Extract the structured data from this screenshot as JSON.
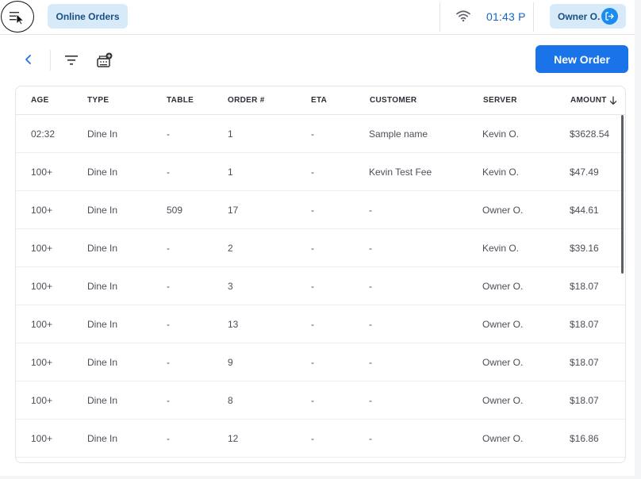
{
  "topbar": {
    "online_orders_label": "Online Orders",
    "time": "01:43 P",
    "user_label": "Owner O."
  },
  "toolbar": {
    "new_order_label": "New Order"
  },
  "table": {
    "columns": [
      "AGE",
      "TYPE",
      "TABLE",
      "ORDER #",
      "ETA",
      "CUSTOMER",
      "SERVER",
      "AMOUNT"
    ],
    "rows": [
      [
        "02:32",
        "Dine In",
        "-",
        "1",
        "-",
        "Sample name",
        "Kevin O.",
        "$3628.54"
      ],
      [
        "100+",
        "Dine In",
        "-",
        "1",
        "-",
        "Kevin Test Fee",
        "Kevin O.",
        "$47.49"
      ],
      [
        "100+",
        "Dine In",
        "509",
        "17",
        "-",
        "-",
        "Owner O.",
        "$44.61"
      ],
      [
        "100+",
        "Dine In",
        "-",
        "2",
        "-",
        "-",
        "Kevin O.",
        "$39.16"
      ],
      [
        "100+",
        "Dine In",
        "-",
        "3",
        "-",
        "-",
        "Owner O.",
        "$18.07"
      ],
      [
        "100+",
        "Dine In",
        "-",
        "13",
        "-",
        "-",
        "Owner O.",
        "$18.07"
      ],
      [
        "100+",
        "Dine In",
        "-",
        "9",
        "-",
        "-",
        "Owner O.",
        "$18.07"
      ],
      [
        "100+",
        "Dine In",
        "-",
        "8",
        "-",
        "-",
        "Owner O.",
        "$18.07"
      ],
      [
        "100+",
        "Dine In",
        "-",
        "12",
        "-",
        "-",
        "Owner O.",
        "$16.86"
      ]
    ]
  },
  "colors": {
    "accent": "#1a73e8",
    "pill_bg": "#d6eaf9",
    "pill_text": "#1b4f80",
    "clock": "#1766c2"
  },
  "icons": {
    "menu": "menu-icon",
    "wifi": "wifi-icon",
    "logout": "logout-icon",
    "back": "chevron-left-icon",
    "filter": "filter-icon",
    "register": "cash-register-icon",
    "sort": "arrow-down-icon"
  }
}
